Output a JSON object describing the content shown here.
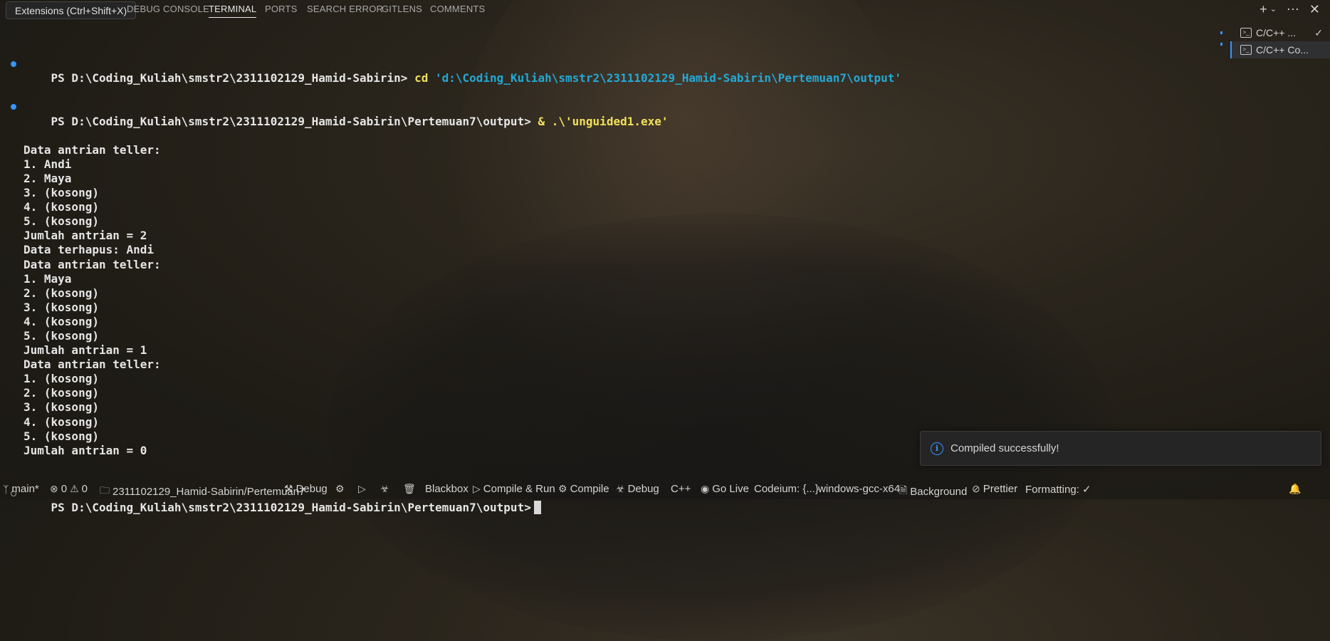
{
  "tabs": {
    "tooltip": "Extensions (Ctrl+Shift+X)",
    "items": [
      "DEBUG CONSOLE",
      "TERMINAL",
      "PORTS",
      "SEARCH ERROR",
      "GITLENS",
      "COMMENTS"
    ]
  },
  "terminal": {
    "prompt1": "PS D:\\Coding_Kuliah\\smstr2\\2311102129_Hamid-Sabirin>",
    "cmd1": "cd",
    "arg1": "'d:\\Coding_Kuliah\\smstr2\\2311102129_Hamid-Sabirin\\Pertemuan7\\output'",
    "prompt2": "PS D:\\Coding_Kuliah\\smstr2\\2311102129_Hamid-Sabirin\\Pertemuan7\\output>",
    "cmd2": "&",
    "arg2": ".\\'unguided1.exe'",
    "output": [
      "Data antrian teller:",
      "1. Andi",
      "2. Maya",
      "3. (kosong)",
      "4. (kosong)",
      "5. (kosong)",
      "Jumlah antrian = 2",
      "Data terhapus: Andi",
      "Data antrian teller:",
      "1. Maya",
      "2. (kosong)",
      "3. (kosong)",
      "4. (kosong)",
      "5. (kosong)",
      "Jumlah antrian = 1",
      "Data antrian teller:",
      "1. (kosong)",
      "2. (kosong)",
      "3. (kosong)",
      "4. (kosong)",
      "5. (kosong)",
      "Jumlah antrian = 0"
    ],
    "prompt3": "PS D:\\Coding_Kuliah\\smstr2\\2311102129_Hamid-Sabirin\\Pertemuan7\\output>"
  },
  "terminal_list": [
    "C/C++ ...",
    "C/C++ Co..."
  ],
  "notification": {
    "text": "Compiled successfully!"
  },
  "statusbar": {
    "branch": "main*",
    "errors": "0",
    "warnings": "0",
    "folder": "2311102129_Hamid-Sabirin/Pertemuan7",
    "debug": "Debug",
    "blackbox": "Blackbox",
    "compile_run": "Compile & Run",
    "compile": "Compile",
    "debug2": "Debug",
    "lang": "C++",
    "golive": "Go Live",
    "codeium": "Codeium: {...}",
    "toolchain": "windows-gcc-x64",
    "background": "Background",
    "prettier": "Prettier",
    "formatting": "Formatting: ✓"
  }
}
